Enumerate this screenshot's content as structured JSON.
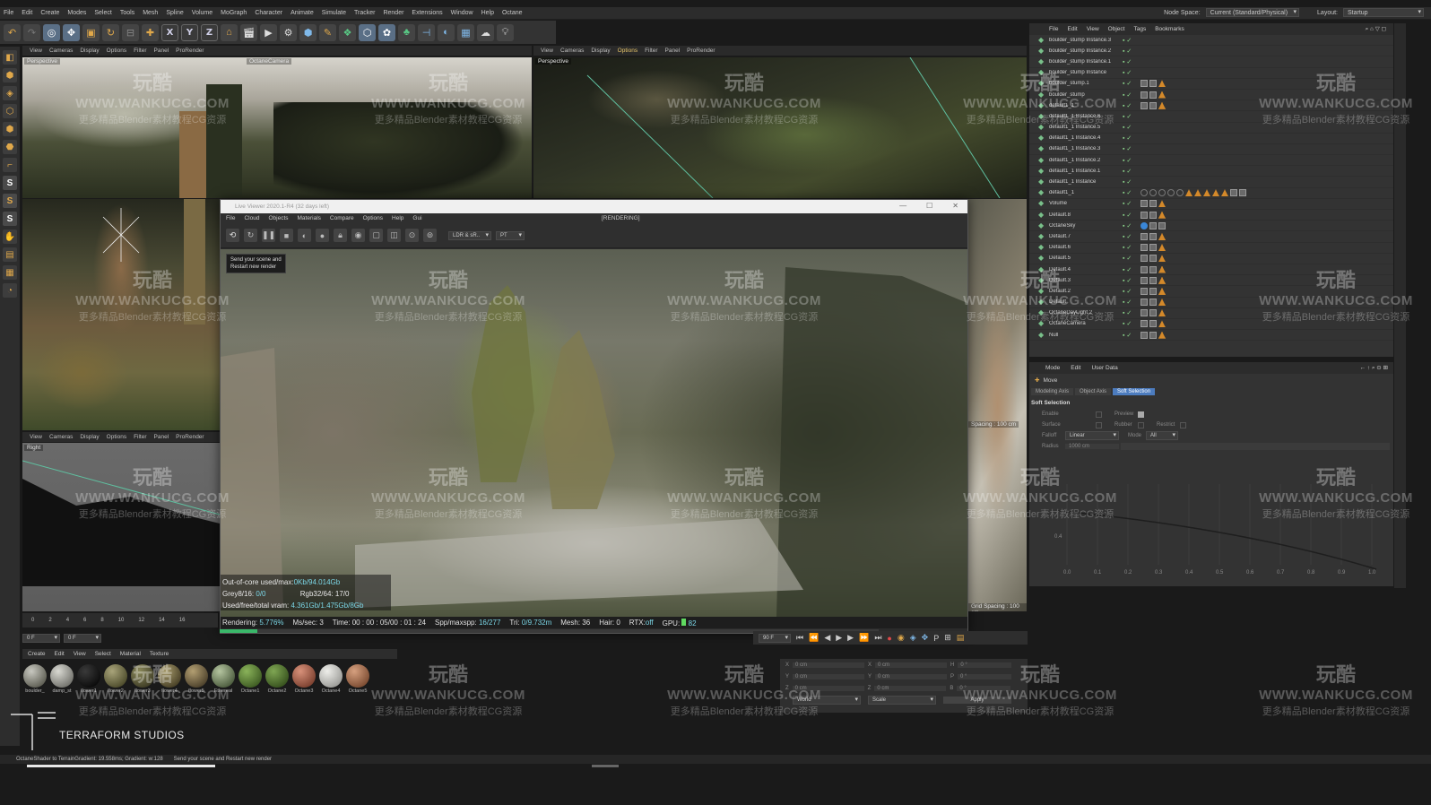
{
  "menubar": {
    "items": [
      "File",
      "Edit",
      "Create",
      "Modes",
      "Select",
      "Tools",
      "Mesh",
      "Spline",
      "Volume",
      "MoGraph",
      "Character",
      "Animate",
      "Simulate",
      "Tracker",
      "Render",
      "Extensions",
      "Window",
      "Help",
      "Octane"
    ],
    "node_space_label": "Node Space:",
    "node_space_value": "Current (Standard/Physical)",
    "layout_label": "Layout:",
    "layout_value": "Startup"
  },
  "toolbar": {
    "axis_x": "X",
    "axis_y": "Y",
    "axis_z": "Z"
  },
  "viewports": {
    "menu": [
      "View",
      "Cameras",
      "Display",
      "Options",
      "Filter",
      "Panel",
      "ProRender"
    ],
    "top_left_label": "Perspective",
    "top_left_camera": "OctaneCamera",
    "top_right_label": "Perspective",
    "bottom_left_label": "Right",
    "right_spacing_top": "Spacing : 100 cm",
    "right_spacing_bottom": "Grid Spacing : 100 cm"
  },
  "live_viewer": {
    "title": "Live Viewer 2020.1-R4 (32 days left)",
    "menu": [
      "File",
      "Cloud",
      "Objects",
      "Materials",
      "Compare",
      "Options",
      "Help",
      "Gui"
    ],
    "status_label": "[RENDERING]",
    "mode_select": "LDR & sR..",
    "pt_select": "PT",
    "tooltip_line1": "Send your scene and",
    "tooltip_line2": "Restart new render",
    "stats": {
      "out_of_core_label": "Out-of-core used/max:",
      "out_of_core_value": "0Kb/94.014Gb",
      "grey_label": "Grey8/16:",
      "grey_value": "0/0",
      "rgb_label": "Rgb32/64:",
      "rgb_value": "17/0",
      "vram_label": "Used/free/total vram:",
      "vram_value": "4.361Gb/1.475Gb/8Gb"
    },
    "status": {
      "rendering_label": "Rendering:",
      "rendering_value": "5.776%",
      "mssec_label": "Ms/sec:",
      "mssec_value": "3",
      "time_label": "Time:",
      "time_value": "00 : 00 : 05/00 : 01 : 24",
      "spp_label": "Spp/maxspp:",
      "spp_value": "16/277",
      "tri_label": "Tri:",
      "tri_value": "0/9.732m",
      "mesh_label": "Mesh:",
      "mesh_value": "36",
      "hair_label": "Hair:",
      "hair_value": "0",
      "rtx_label": "RTX:",
      "rtx_value": "off",
      "gpu_label": "GPU:",
      "gpu_value": "82"
    }
  },
  "object_manager": {
    "menu": [
      "File",
      "Edit",
      "View",
      "Object",
      "Tags",
      "Bookmarks"
    ],
    "objects": [
      "boulder_stump Instance.3",
      "boulder_stump Instance.2",
      "boulder_stump Instance.1",
      "boulder_stump Instance",
      "boulder_stump.1",
      "boulder_stump",
      "default1_1",
      "default1_1 Instance.6",
      "default1_1 Instance.5",
      "default1_1 Instance.4",
      "default1_1 Instance.3",
      "default1_1 Instance.2",
      "default1_1 Instance.1",
      "default1_1 Instance",
      "default1_1",
      "Volume",
      "Default.8",
      "OctaneSky",
      "Default.7",
      "Default.6",
      "Default.5",
      "Default.4",
      "Default.3",
      "Default.2",
      "Default",
      "OctaneDayLight.2",
      "OctaneCamera",
      "Null"
    ]
  },
  "attribute_manager": {
    "menu": [
      "Mode",
      "Edit",
      "User Data"
    ],
    "tool_name": "Move",
    "tabs": [
      "Modeling Axis",
      "Object Axis",
      "Soft Selection"
    ],
    "section_title": "Soft Selection",
    "fields": [
      "Enable",
      "Preview",
      "Surface",
      "Rubber",
      "Restrict",
      "Falloff",
      "Linear",
      "Mode",
      "All",
      "Radius",
      "1000 cm"
    ],
    "curve_ticks": [
      "0.0",
      "0.1",
      "0.2",
      "0.3",
      "0.4",
      "0.5",
      "0.6",
      "0.7",
      "0.8",
      "0.9",
      "1.0"
    ],
    "curve_y_label": "0.4"
  },
  "timeline": {
    "ticks": [
      "0",
      "2",
      "4",
      "6",
      "8",
      "10",
      "12",
      "14",
      "16"
    ],
    "frame_start": "0 F",
    "frame_current": "0 F",
    "frame_end": "90 F"
  },
  "material_manager": {
    "menu": [
      "Create",
      "Edit",
      "View",
      "Select",
      "Material",
      "Texture"
    ],
    "materials": [
      {
        "label": "boulder_",
        "color1": "#c8c8c0",
        "color2": "#5b5b50"
      },
      {
        "label": "damp_st",
        "color1": "#d9d9d2",
        "color2": "#70706a"
      },
      {
        "label": "flower1",
        "color1": "#3a3a3a",
        "color2": "#0a0a0a"
      },
      {
        "label": "flower2",
        "color1": "#a9a47a",
        "color2": "#4b4a2a"
      },
      {
        "label": "flower3",
        "color1": "#8c8a5c",
        "color2": "#3d3b24"
      },
      {
        "label": "flower4",
        "color1": "#a79b6c",
        "color2": "#463e25"
      },
      {
        "label": "flower5",
        "color1": "#b39f72",
        "color2": "#4a3f2a"
      },
      {
        "label": "Ethereal",
        "color1": "#b5c5a0",
        "color2": "#4a5a3c"
      },
      {
        "label": "Octane1",
        "color1": "#8ab35a",
        "color2": "#3d5a22"
      },
      {
        "label": "Octane2",
        "color1": "#7fa653",
        "color2": "#36501d"
      },
      {
        "label": "Octane3",
        "color1": "#d8917a",
        "color2": "#7a3f2e"
      },
      {
        "label": "Octane4",
        "color1": "#eeeeea",
        "color2": "#9a9a96"
      },
      {
        "label": "Octane5",
        "color1": "#d6a07f",
        "color2": "#7a4a30"
      }
    ]
  },
  "coords": {
    "labels": [
      "X",
      "Y",
      "Z"
    ],
    "values": [
      "0 cm",
      "0 cm",
      "0 cm"
    ],
    "mid_values": [
      "0 cm",
      "0 cm",
      "0 cm"
    ],
    "rot_labels": [
      "H",
      "P",
      "B"
    ],
    "rot_values": [
      "0 °",
      "0 °",
      "0 °"
    ],
    "world_select": "World",
    "scale_select": "Scale",
    "apply_button": "Apply"
  },
  "statusbar": {
    "message": "OctaneShader to TerrainGradient: 19.558ms; Gradient: w:128",
    "hint": "Send your scene and Restart new render"
  },
  "logo": {
    "text": "TERRAFORM STUDIOS"
  },
  "watermark": {
    "line1": "玩酷",
    "line2": "WWW.WANKUCG.COM",
    "line3": "更多精品Blender素材教程CG资源"
  }
}
